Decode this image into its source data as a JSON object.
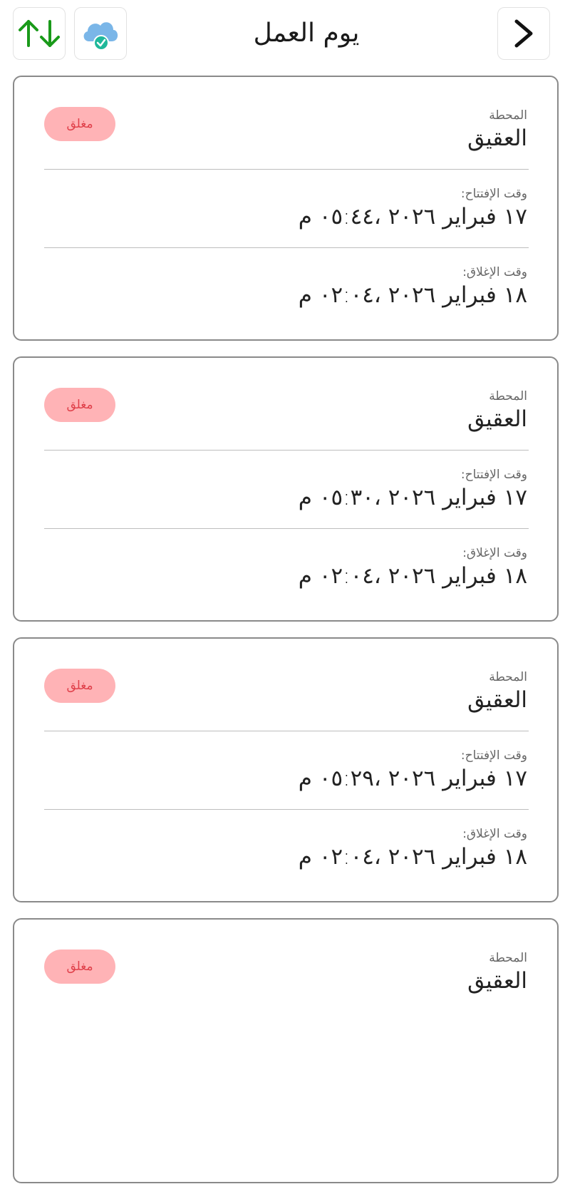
{
  "header": {
    "title": "يوم العمل",
    "sort_icon": "sort-up-down-arrows",
    "cloud_icon": "cloud-synced-check",
    "back_icon": "chevron-right",
    "colors": {
      "sort_arrows": "#1a9a1a",
      "cloud": "#7ab6e8",
      "check": "#1fb89a"
    }
  },
  "cards": [
    {
      "status": "مغلق",
      "station_label": "المحطة",
      "station_value": "العقيق",
      "open_label": "وقت الإفتتاح:",
      "open_value": "١٧ فبراير ٢٠٢٦ ،٠٥:٤٤ م",
      "close_label": "وقت الإغلاق:",
      "close_value": "١٨ فبراير ٢٠٢٦ ،٠٢:٠٤ م"
    },
    {
      "status": "مغلق",
      "station_label": "المحطة",
      "station_value": "العقيق",
      "open_label": "وقت الإفتتاح:",
      "open_value": "١٧ فبراير ٢٠٢٦ ،٠٥:٣٠ م",
      "close_label": "وقت الإغلاق:",
      "close_value": "١٨ فبراير ٢٠٢٦ ،٠٢:٠٤ م"
    },
    {
      "status": "مغلق",
      "station_label": "المحطة",
      "station_value": "العقيق",
      "open_label": "وقت الإفتتاح:",
      "open_value": "١٧ فبراير ٢٠٢٦ ،٠٥:٢٩ م",
      "close_label": "وقت الإغلاق:",
      "close_value": "١٨ فبراير ٢٠٢٦ ،٠٢:٠٤ م"
    },
    {
      "status": "مغلق",
      "station_label": "المحطة",
      "station_value": "العقيق"
    }
  ]
}
